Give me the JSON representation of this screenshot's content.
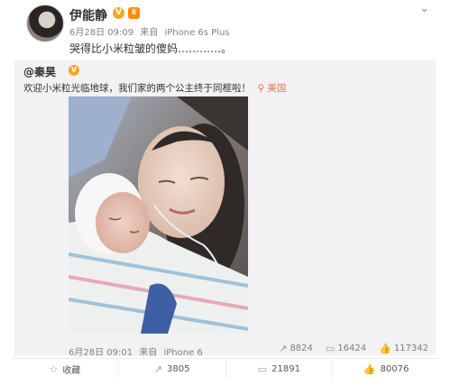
{
  "post": {
    "username": "伊能静",
    "meta": {
      "date": "6月28日 09:09",
      "source_prefix": "来自",
      "device": "iPhone 6s Plus"
    },
    "text": "哭得比小米粒皱的傻妈…………。",
    "icons": {
      "verified": "verified-badge-icon",
      "vip": "vip-crown-icon",
      "menu": "chevron-down-icon"
    }
  },
  "repost": {
    "username": "@秦昊",
    "text": "欢迎小米粒光临地球，我们家的两个公主终于同框啦！",
    "location": "美国",
    "meta": {
      "date": "6月28日 09:01",
      "source_prefix": "来自",
      "device": "iPhone 6"
    },
    "actions": {
      "repost": "8824",
      "comment": "16424",
      "like": "117342"
    },
    "photo_description_icon": "newborn-mother-photo"
  },
  "footer": {
    "collect": "收藏",
    "repost": "3805",
    "comment": "21891",
    "like": "80076"
  },
  "colors": {
    "accent": "#eb7350",
    "meta": "#808080",
    "repost_bg": "#f2f2f5",
    "badge": "#f5a623"
  }
}
